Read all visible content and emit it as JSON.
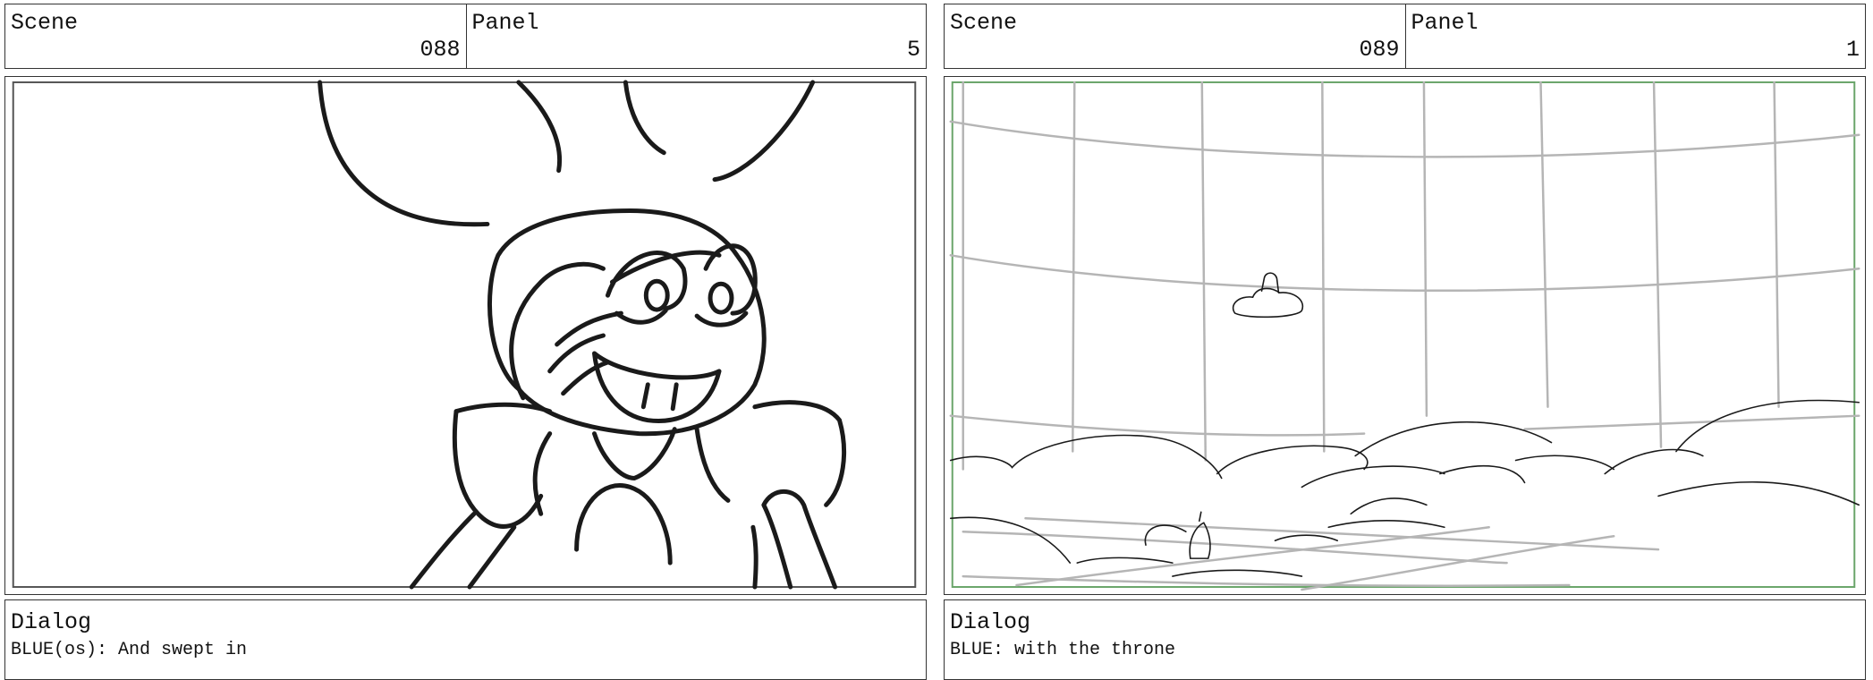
{
  "boards": [
    {
      "scene_label": "Scene",
      "scene_number": "088",
      "panel_label": "Panel",
      "panel_number": "5",
      "dialog_label": "Dialog",
      "dialog_text": "BLUE(os): And swept in"
    },
    {
      "scene_label": "Scene",
      "scene_number": "089",
      "panel_label": "Panel",
      "panel_number": "1",
      "dialog_label": "Dialog",
      "dialog_text": "BLUE: with the throne"
    }
  ],
  "colors": {
    "border": "#333333",
    "safe_frame_left": "#555555",
    "safe_frame_right": "#6aa56a",
    "sketch_ink": "#1a1a1a",
    "grid_lines": "#b5b5b5"
  }
}
